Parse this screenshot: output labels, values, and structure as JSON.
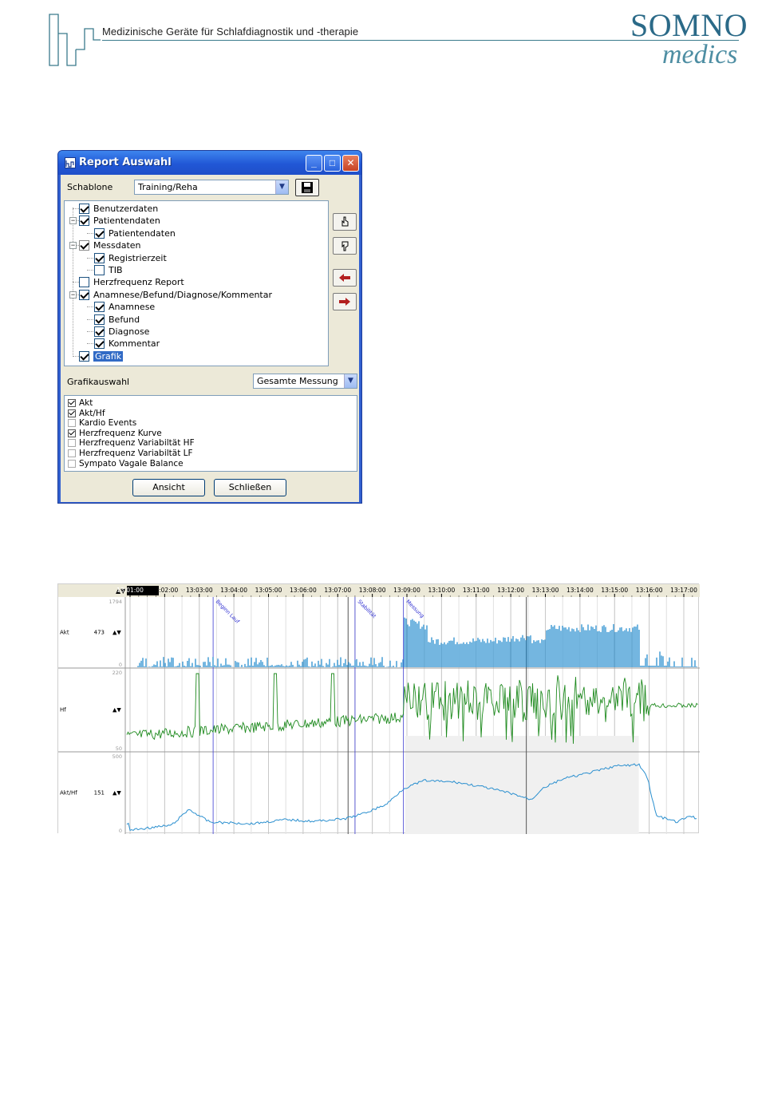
{
  "header": {
    "subtitle": "Medizinische Geräte für Schlafdiagnostik und -therapie",
    "brand_top": "SOMNO",
    "brand_bottom": "medics",
    "brand_color": "#2b6a88"
  },
  "dialog": {
    "title": "Report Auswahl",
    "icons": {
      "app": "app-icon",
      "minimize": "minimize-icon",
      "maximize": "maximize-icon",
      "close": "close-icon"
    },
    "schablone_label": "Schablone",
    "schablone_value": "Training/Reha",
    "save_icon": "floppy-disk-icon",
    "tree": [
      {
        "label": "Benutzerdaten",
        "level": 0,
        "checked": true,
        "expander": false
      },
      {
        "label": "Patientendaten",
        "level": 0,
        "checked": true,
        "expander": true
      },
      {
        "label": "Patientendaten",
        "level": 1,
        "checked": true,
        "expander": false
      },
      {
        "label": "Messdaten",
        "level": 0,
        "checked": true,
        "expander": true,
        "gray": true
      },
      {
        "label": "Registrierzeit",
        "level": 1,
        "checked": true,
        "expander": false
      },
      {
        "label": "TIB",
        "level": 1,
        "checked": false,
        "expander": false
      },
      {
        "label": "Herzfrequenz Report",
        "level": 0,
        "checked": false,
        "expander": false
      },
      {
        "label": "Anamnese/Befund/Diagnose/Kommentar",
        "level": 0,
        "checked": true,
        "expander": true
      },
      {
        "label": "Anamnese",
        "level": 1,
        "checked": true,
        "expander": false
      },
      {
        "label": "Befund",
        "level": 1,
        "checked": true,
        "expander": false
      },
      {
        "label": "Diagnose",
        "level": 1,
        "checked": true,
        "expander": false
      },
      {
        "label": "Kommentar",
        "level": 1,
        "checked": true,
        "expander": false
      },
      {
        "label": "Grafik",
        "level": 0,
        "checked": true,
        "expander": false,
        "selected": true
      }
    ],
    "side_buttons": [
      "move-up-icon",
      "move-down-icon",
      "arrow-left-icon",
      "arrow-right-icon"
    ],
    "grafik_label": "Grafikauswahl",
    "grafik_value": "Gesamte Messung",
    "grafik_items": [
      {
        "label": "Akt",
        "checked": true
      },
      {
        "label": "Akt/Hf",
        "checked": true
      },
      {
        "label": "Kardio Events",
        "checked": false
      },
      {
        "label": "Herzfrequenz Kurve",
        "checked": true
      },
      {
        "label": "Herzfrequenz Variabiltät HF",
        "checked": false
      },
      {
        "label": "Herzfrequenz Variabiltät LF",
        "checked": false
      },
      {
        "label": "Sympato Vagale Balance",
        "checked": false
      }
    ],
    "btn_ansicht": "Ansicht",
    "btn_schliessen": "Schließen"
  },
  "chart_data": {
    "type": "line",
    "time_ticks": [
      "13:01:00",
      "13:02:00",
      "13:03:00",
      "13:04:00",
      "13:05:00",
      "13:06:00",
      "13:07:00",
      "13:08:00",
      "13:09:00",
      "13:10:00",
      "13:11:00",
      "13:12:00",
      "13:13:00",
      "13:14:00",
      "13:15:00",
      "13:16:00",
      "13:17:00"
    ],
    "markers": [
      {
        "label": "Beginn Lauf",
        "t": 2.4
      },
      {
        "label": "Stabilität",
        "t": 6.5
      },
      {
        "label": "Messung",
        "t": 7.9
      }
    ],
    "tracks": [
      {
        "name": "Akt",
        "value": "473",
        "ymax": "1794",
        "ymin": "0",
        "color": "#2a8fcf"
      },
      {
        "name": "Hf",
        "value": "",
        "ymax": "220",
        "ymin": "50",
        "color": "#1e8a1e"
      },
      {
        "name": "Akt/Hf",
        "value": "151",
        "ymax": "500",
        "ymin": "0",
        "color": "#2a8fcf"
      }
    ],
    "sort_icon": "sort-arrows-icon"
  }
}
